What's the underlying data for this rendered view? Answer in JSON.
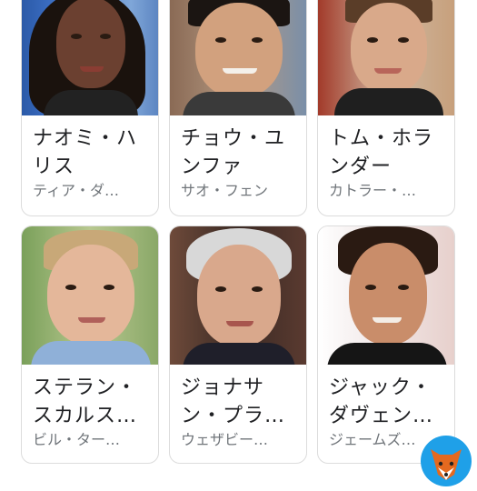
{
  "cards": [
    {
      "name": "ナオミ・ハ\nリス",
      "sub": "ティア・ダ…",
      "photo": "portrait-photo"
    },
    {
      "name": "チョウ・ユ\nンファ",
      "sub": "サオ・フェン",
      "photo": "portrait-photo"
    },
    {
      "name": "トム・ホラ\nンダー",
      "sub": "カトラー・…",
      "photo": "portrait-photo"
    },
    {
      "name": "ステラン・\nスカルス…",
      "sub": "ビル・ター…",
      "photo": "portrait-photo"
    },
    {
      "name": "ジョナサ\nン・プラ…",
      "sub": "ウェザビー…",
      "photo": "portrait-photo"
    },
    {
      "name": "ジャック・\nダヴェン…",
      "sub": "ジェームズ…",
      "photo": "portrait-photo"
    }
  ],
  "colors": {
    "card_border": "#dcdcdc",
    "name_text": "#202124",
    "sub_text": "#70757a"
  },
  "overlay": {
    "logo_icon": "fox-mascot-icon"
  }
}
